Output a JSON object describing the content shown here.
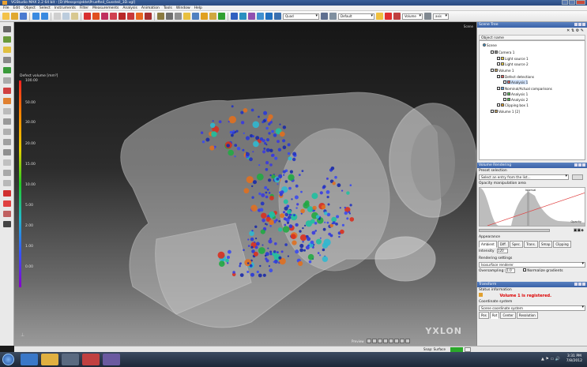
{
  "window": {
    "title": "VGStudio MAX 2.2 64 bit - [D:\\Messprojekte\\Pruefteil_Gussteil_3D.vgl]"
  },
  "menu": [
    "File",
    "Edit",
    "Object",
    "Select",
    "Instruments",
    "Filter",
    "Measurements",
    "Analysis",
    "Animation",
    "Tools",
    "Window",
    "Help"
  ],
  "toolbar": {
    "quad_label": "Quad",
    "default_label": "Default",
    "volume_label": "Volume",
    "zoom_label": "axis"
  },
  "viewport": {
    "label": "Scene",
    "legend_title": "Defect volume [mm³]",
    "legend_ticks": [
      "100.00",
      "50.00",
      "30.00",
      "20.00",
      "15.00",
      "10.00",
      "5.00",
      "2.00",
      "1.00",
      "0.00"
    ],
    "brand": "YXLON",
    "axes_glyph": "⊥",
    "preview_label": "Preview"
  },
  "scene_tree": {
    "title": "Scene Tree",
    "column": "Object name",
    "nodes": [
      {
        "label": "Scene",
        "icon": "globe-icon"
      },
      {
        "label": "Camera 1",
        "icon": "camera-icon"
      },
      {
        "label": "Light source 1",
        "icon": "light-icon"
      },
      {
        "label": "Light source 2",
        "icon": "light-icon"
      },
      {
        "label": "Volume 1",
        "icon": "volume-icon"
      },
      {
        "label": "Defect detections",
        "icon": "analysis-icon"
      },
      {
        "label": "Analysis 1",
        "icon": "analysis-icon"
      },
      {
        "label": "Nominal/Actual comparisons",
        "icon": "folder-icon"
      },
      {
        "label": "Analysis 1",
        "icon": "analysis-icon"
      },
      {
        "label": "Analysis 2",
        "icon": "analysis-icon"
      },
      {
        "label": "Clipping box 1",
        "icon": "clipping-icon"
      },
      {
        "label": "Volume 1 [2]",
        "icon": "volume-icon"
      }
    ]
  },
  "volume_rendering": {
    "title": "Volume Rendering",
    "preset_label": "Preset selection",
    "preset_value": "Select an entry from the list...",
    "opacity_label": "Opacity manipulation area",
    "interval_label": "Interval",
    "opacity_sublabel": "Opacity",
    "appearance_label": "Appearance",
    "tabs": [
      "Ambient",
      "Diff.",
      "Spec.",
      "Trans.",
      "Smap",
      "Clipping"
    ],
    "intensity_label": "Intensity",
    "intensity_value": "120",
    "rendering_label": "Rendering settings",
    "renderer": "Isosurface renderer",
    "oversampling_label": "Oversampling:",
    "oversampling_value": "1.0",
    "normalize_label": "Normalize gradients"
  },
  "transform": {
    "title": "Transform",
    "status_label": "Status information",
    "status_message": "Volume 1 is registered.",
    "coord_label": "Coordinate system",
    "coord_value": "Scene coordinate system",
    "tabs": [
      "Pos",
      "Rot",
      "Center",
      "Resolution"
    ]
  },
  "statusbar": {
    "snap_label": "Snap: Surface"
  },
  "taskbar": {
    "time": "3:31 PM",
    "date": "7/8/2012"
  },
  "colors": {
    "accent": "#3a62a8",
    "registered": "#dd0000",
    "snap": "#2aa82a"
  }
}
